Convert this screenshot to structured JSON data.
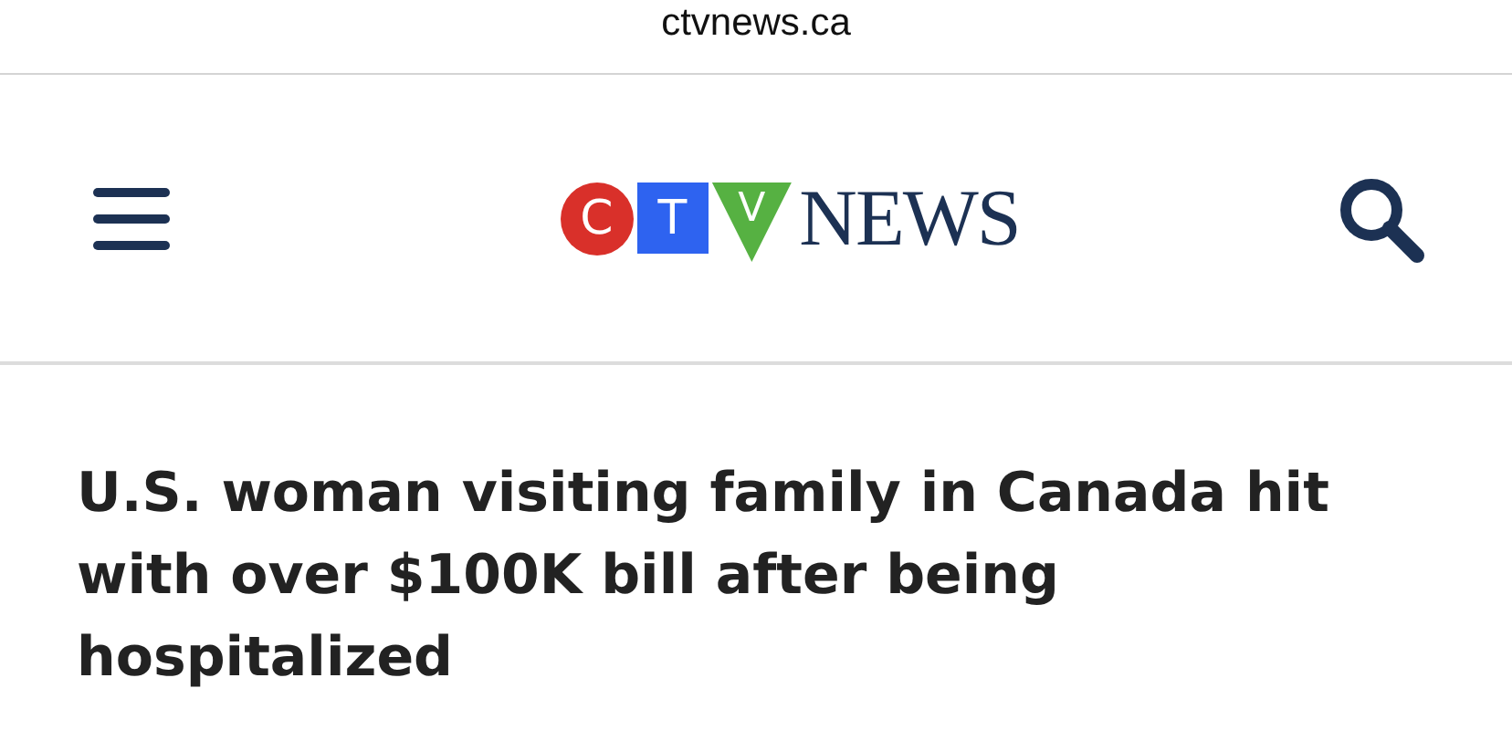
{
  "address_bar": {
    "url": "ctvnews.ca"
  },
  "header": {
    "logo": {
      "letters": [
        "C",
        "T",
        "V"
      ],
      "wordmark": "NEWS"
    }
  },
  "article": {
    "headline": "U.S. woman visiting family in Canada hit with over $100K bill after being hospitalized"
  }
}
